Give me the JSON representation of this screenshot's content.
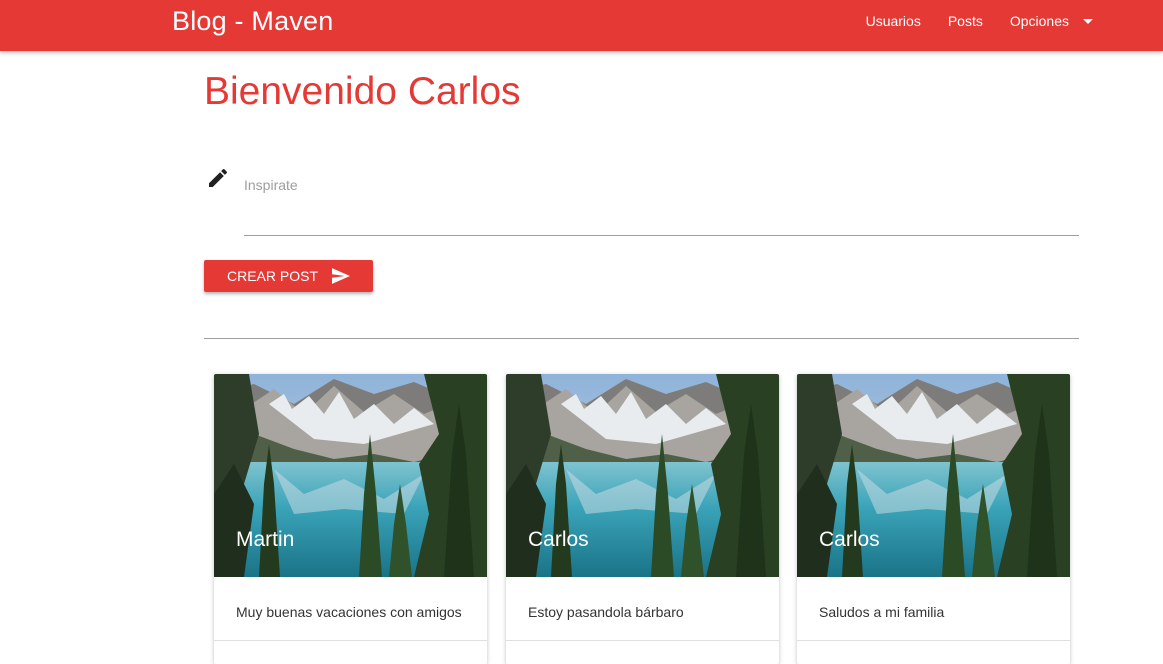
{
  "navbar": {
    "brand": "Blog - Maven",
    "links": [
      "Usuarios",
      "Posts"
    ],
    "dropdown_label": "Opciones",
    "color": "#e53935"
  },
  "main": {
    "welcome": "Bienvenido Carlos",
    "input_placeholder": "Inspirate",
    "input_value": "",
    "create_button_label": "CREAR POST",
    "icons": [
      "pencil-icon",
      "send-icon",
      "caret-down-icon"
    ]
  },
  "posts": [
    {
      "author": "Martin",
      "text": "Muy buenas vacaciones con amigos"
    },
    {
      "author": "Carlos",
      "text": "Estoy pasandola bárbaro"
    },
    {
      "author": "Carlos",
      "text": "Saludos a mi familia"
    }
  ]
}
